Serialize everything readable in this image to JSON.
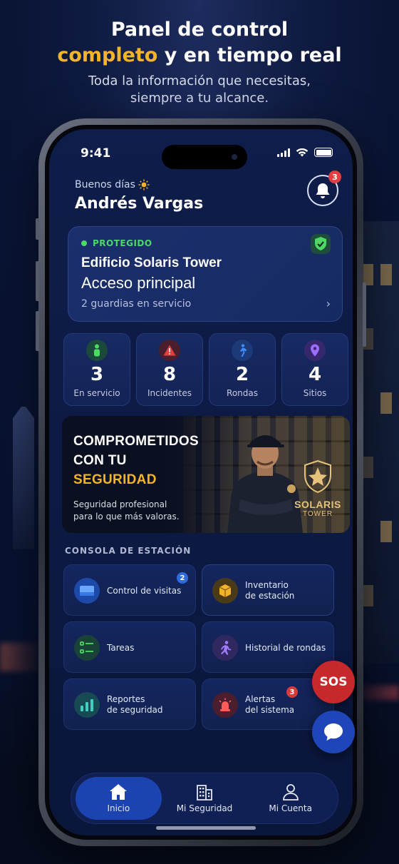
{
  "headline": {
    "line1": "Panel de control",
    "line2_accent": "completo",
    "line2_rest": " y en tiempo real",
    "sub1": "Toda la información que necesitas,",
    "sub2": "siempre a tu alcance."
  },
  "statusbar": {
    "time": "9:41"
  },
  "greeting": {
    "salutation": "Buenos días",
    "name": "Andrés Vargas"
  },
  "notifications": {
    "count": "3"
  },
  "site": {
    "status": "PROTEGIDO",
    "building": "Edificio Solaris Tower",
    "access": "Acceso principal",
    "guards": "2 guardias en servicio"
  },
  "stats": [
    {
      "value": "3",
      "label": "En servicio",
      "icon": "person-icon",
      "color": "#4cd964"
    },
    {
      "value": "8",
      "label": "Incidentes",
      "icon": "warning-icon",
      "color": "#e24040"
    },
    {
      "value": "2",
      "label": "Rondas",
      "icon": "walking-icon",
      "color": "#3d8bff"
    },
    {
      "value": "4",
      "label": "Sitios",
      "icon": "location-pin-icon",
      "color": "#a06bff"
    }
  ],
  "banner": {
    "line1": "COMPROMETIDOS",
    "line2": "CON TU",
    "line3": "SEGURIDAD",
    "desc1": "Seguridad profesional",
    "desc2": "para lo que más valoras.",
    "logo1": "SOLARIS",
    "logo2": "TOWER"
  },
  "console": {
    "title": "CONSOLA DE ESTACIÓN",
    "tiles": [
      {
        "label1": "Control de visitas",
        "label2": "",
        "icon": "id-card-icon",
        "badge": "2"
      },
      {
        "label1": "Inventario",
        "label2": "de estación",
        "icon": "box-icon",
        "badge": ""
      },
      {
        "label1": "Tareas",
        "label2": "",
        "icon": "checklist-icon",
        "badge": ""
      },
      {
        "label1": "Historial de rondas",
        "label2": "",
        "icon": "running-icon",
        "badge": ""
      },
      {
        "label1": "Reportes",
        "label2": "de seguridad",
        "icon": "bar-chart-icon",
        "badge": ""
      },
      {
        "label1": "Alertas",
        "label2": "del sistema",
        "icon": "alarm-icon",
        "badge": "3"
      }
    ]
  },
  "actions": {
    "sos": "SOS"
  },
  "tabs": [
    {
      "label": "Inicio",
      "icon": "home-icon"
    },
    {
      "label": "Mi Seguridad",
      "icon": "building-icon"
    },
    {
      "label": "Mi Cuenta",
      "icon": "user-icon"
    }
  ],
  "colors": {
    "accent": "#f3b429",
    "protected": "#4cd964",
    "sos": "#c6282b",
    "primary": "#1c44b0"
  }
}
